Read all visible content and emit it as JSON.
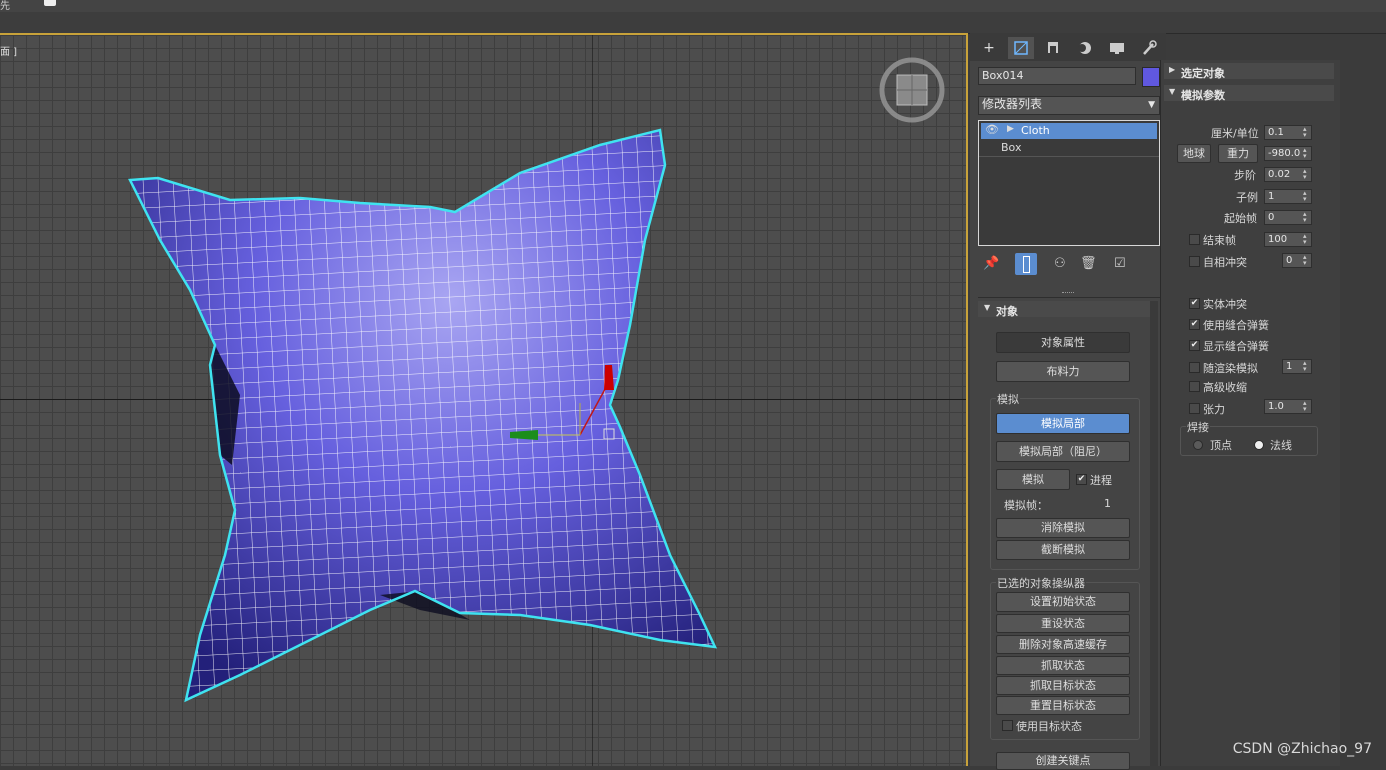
{
  "topbar": {
    "label": "先"
  },
  "viewport": {
    "label": "面 ]",
    "object_color": "#5a56d8",
    "selection_color": "#3fe3f0"
  },
  "command_panel": {
    "tabs": [
      "create-icon",
      "modify-icon",
      "hierarchy-icon",
      "motion-icon",
      "display-icon",
      "utilities-icon"
    ],
    "object_name": "Box014",
    "object_color": "#6058e0",
    "modifier_list": "修改器列表",
    "stack": [
      {
        "label": "Cloth",
        "selected": true
      },
      {
        "label": "Box",
        "selected": false
      }
    ],
    "object_rollout": {
      "title": "对象",
      "object_props": "对象属性",
      "cloth_forces": "布料力",
      "sim_group": "模拟",
      "sim_local": "模拟局部",
      "sim_local_damped": "模拟局部（阻尼）",
      "simulate": "模拟",
      "progress_label": "进程",
      "sim_frame_label": "模拟帧：",
      "sim_frame_value": "1",
      "erase_sim": "消除模拟",
      "truncate_sim": "截断模拟",
      "selected_group": "已选的对象操纵器",
      "set_initial": "设置初始状态",
      "reset_state": "重设状态",
      "delete_cache": "删除对象高速缓存",
      "grab_state": "抓取状态",
      "grab_target": "抓取目标状态",
      "reset_target": "重置目标状态",
      "use_target": "使用目标状态",
      "create_keys": "创建关键点"
    }
  },
  "sim_params": {
    "selected_title": "选定对象",
    "title": "模拟参数",
    "cm_per_unit_label": "厘米/单位",
    "cm_per_unit": "0.1",
    "earth_btn": "地球",
    "gravity_btn": "重力",
    "gravity": "-980.0",
    "step_label": "步阶",
    "step": "0.02",
    "subsample_label": "子例",
    "subsample": "1",
    "start_label": "起始帧",
    "start": "0",
    "end_label": "结束帧",
    "end": "100",
    "self_collision_label": "自相冲突",
    "self_collision": "0",
    "solid_collision": "实体冲突",
    "use_sew": "使用缝合弹簧",
    "show_sew": "显示缝合弹簧",
    "render_sim": "随渲染模拟",
    "render_sim_value": "1",
    "adv_pinch": "高级收缩",
    "tension_label": "张力",
    "tension": "1.0",
    "weld_group": "焊接",
    "vertex": "顶点",
    "normal": "法线"
  },
  "watermark": "CSDN @Zhichao_97"
}
